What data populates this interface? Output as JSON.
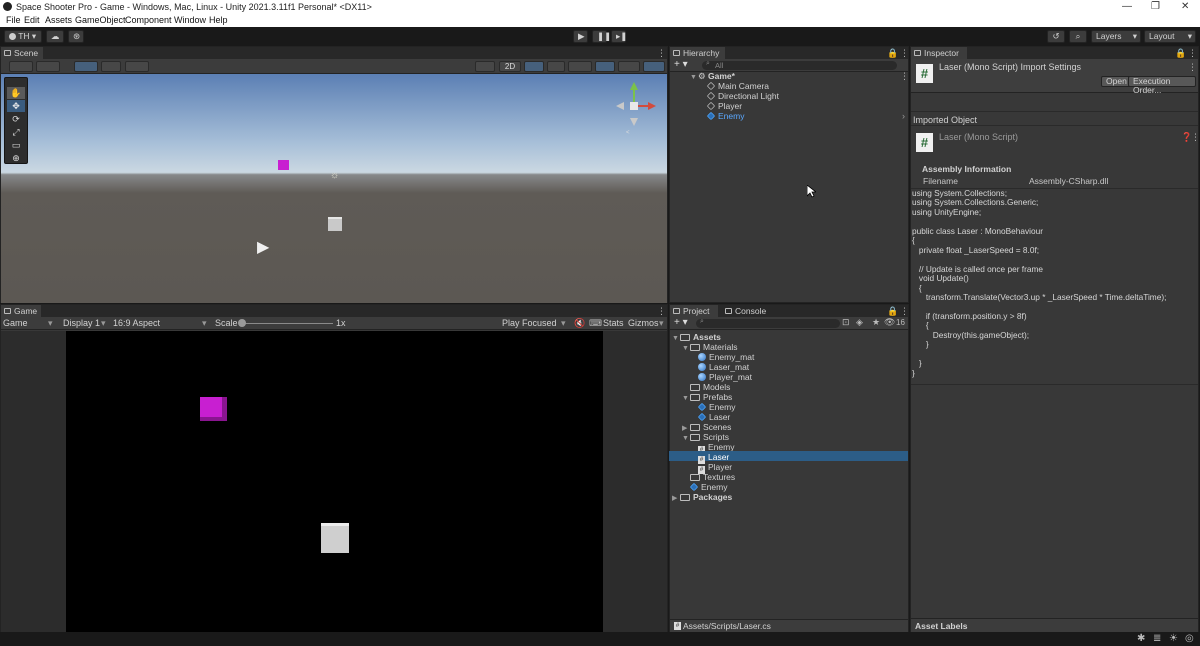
{
  "window": {
    "title": "Space Shooter Pro - Game - Windows, Mac, Linux - Unity 2021.3.11f1 Personal* <DX11>",
    "controls": [
      "—",
      "❐",
      "✕"
    ]
  },
  "menu": [
    "File",
    "Edit",
    "Assets",
    "GameObject",
    "Component",
    "Window",
    "Help"
  ],
  "toolbar": {
    "account": "TH",
    "layers": "Layers",
    "layout": "Layout"
  },
  "scene": {
    "tab": "Scene",
    "button_2d": "2D"
  },
  "game": {
    "tab": "Game",
    "mode": "Game",
    "display": "Display 1",
    "aspect": "16:9 Aspect",
    "scale_label": "Scale",
    "scale_value": "1x",
    "play_focused": "Play Focused",
    "stats": "Stats",
    "gizmos": "Gizmos"
  },
  "hierarchy": {
    "tab": "Hierarchy",
    "search_placeholder": "All",
    "scene_name": "Game*",
    "items": [
      "Main Camera",
      "Directional Light",
      "Player",
      "Enemy"
    ]
  },
  "project": {
    "tab": "Project",
    "console_tab": "Console",
    "hidden_count": "16",
    "root": "Assets",
    "materials": "Materials",
    "mat_items": [
      "Enemy_mat",
      "Laser_mat",
      "Player_mat"
    ],
    "models": "Models",
    "prefabs": "Prefabs",
    "prefab_items": [
      "Enemy",
      "Laser"
    ],
    "scenes": "Scenes",
    "scripts": "Scripts",
    "script_items": [
      "Enemy",
      "Laser",
      "Player"
    ],
    "textures": "Textures",
    "enemy_root": "Enemy",
    "packages": "Packages",
    "path": "Assets/Scripts/Laser.cs"
  },
  "inspector": {
    "tab": "Inspector",
    "header_title": "Laser (Mono Script) Import Settings",
    "open_btn": "Open",
    "exec_btn": "Execution Order...",
    "imported_object": "Imported Object",
    "object_title": "Laser (Mono Script)",
    "assembly_info": "Assembly Information",
    "filename_label": "Filename",
    "filename_value": "Assembly-CSharp.dll",
    "code": "using System.Collections;\nusing System.Collections.Generic;\nusing UnityEngine;\n\npublic class Laser : MonoBehaviour\n{\n   private float _LaserSpeed = 8.0f;\n\n   // Update is called once per frame\n   void Update()\n   {\n      transform.Translate(Vector3.up * _LaserSpeed * Time.deltaTime);\n\n      if (transform.position.y > 8f)\n      {\n         Destroy(this.gameObject);\n      }\n\n   }\n}",
    "asset_labels": "Asset Labels"
  },
  "colors": {
    "scene_sky_top": "#5b7fb4",
    "scene_ground": "#5c5853",
    "selection": "#2c5d87",
    "enemy_cube": "#c81fd1"
  }
}
